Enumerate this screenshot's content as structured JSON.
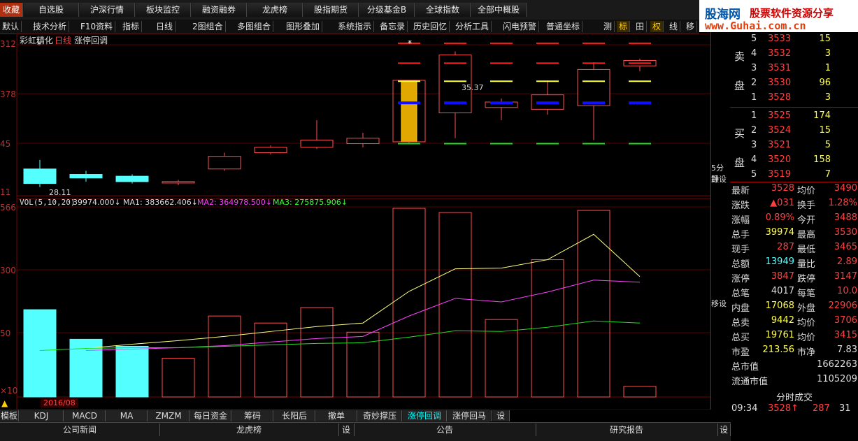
{
  "top_menu": [
    "收藏",
    "自选股",
    "沪深行情",
    "板块监控",
    "融资融券",
    "龙虎榜",
    "股指期货",
    "分级基金B",
    "全球指数",
    "全部中概股"
  ],
  "logo": {
    "brand": "股海网",
    "slogan": "股票软件资源分享",
    "url": "www.Guhai.com.cn"
  },
  "toolbar": [
    "默认",
    "技术分析",
    "F10资料",
    "指标",
    "日线",
    "2图组合",
    "多图组合",
    "图形叠加",
    "系统指示",
    "备忘录",
    "历史回忆",
    "分析工具",
    "闪电预警",
    "普通坐标",
    "测",
    "标",
    "田",
    "权",
    "线",
    "移"
  ],
  "chart": {
    "title": "彩虹精化",
    "period": "日线",
    "indicator": "涨停回调",
    "price_axis": [
      "312",
      "378",
      "45",
      "11"
    ],
    "vol_axis": [
      "566",
      "300",
      "50",
      "×10"
    ],
    "high_annot": "35.37",
    "low_annot": "28.11",
    "date_label": "2016/08",
    "vol_title": "VOL(5,10,20)",
    "vol_val": "39974.000↓",
    "ma1": "MA1: 383662.406↓",
    "ma2": "MA2: 364978.500↓",
    "ma3": "MA3: 275875.906↓"
  },
  "chart_data": {
    "type": "candlestick",
    "candles": [
      {
        "o": 28.9,
        "c": 28.1,
        "h": 29.4,
        "l": 27.9
      },
      {
        "o": 28.6,
        "c": 28.4,
        "h": 28.8,
        "l": 28.2
      },
      {
        "o": 28.5,
        "c": 28.2,
        "h": 28.6,
        "l": 28.1
      },
      {
        "o": 28.2,
        "c": 28.2,
        "h": 28.3,
        "l": 28.0
      },
      {
        "o": 28.9,
        "c": 29.6,
        "h": 29.8,
        "l": 28.8
      },
      {
        "o": 29.8,
        "c": 30.1,
        "h": 30.2,
        "l": 29.7
      },
      {
        "o": 30.1,
        "c": 30.5,
        "h": 31.6,
        "l": 30.0
      },
      {
        "o": 30.3,
        "c": 30.6,
        "h": 30.9,
        "l": 30.1
      },
      {
        "o": 30.4,
        "c": 33.8,
        "h": 33.8,
        "l": 30.3
      },
      {
        "o": 32.0,
        "c": 35.2,
        "h": 35.4,
        "l": 30.6
      },
      {
        "o": 32.3,
        "c": 32.6,
        "h": 32.8,
        "l": 31.6
      },
      {
        "o": 32.2,
        "c": 33.0,
        "h": 33.8,
        "l": 31.9
      },
      {
        "o": 32.4,
        "c": 34.4,
        "h": 34.8,
        "l": 30.5
      },
      {
        "o": 34.6,
        "c": 34.9,
        "h": 35.0,
        "l": 34.3
      }
    ],
    "volume": [
      12.4,
      8.2,
      7.2,
      5.5,
      11.5,
      10.5,
      12.7,
      9.2,
      26.8,
      26.2,
      11.0,
      19.5,
      26.5,
      1.5
    ],
    "ma_yellow": [
      null,
      6.9,
      7.5,
      8.0,
      8.6,
      9.3,
      10.0,
      10.5,
      15.0,
      18.2,
      18.3,
      19.5,
      23.1,
      17.1
    ],
    "ma_magenta": [
      null,
      6.6,
      6.8,
      7.0,
      7.3,
      7.8,
      8.3,
      8.6,
      11.5,
      14.0,
      13.5,
      14.9,
      16.6,
      16.3
    ],
    "ma_green": [
      6.6,
      6.9,
      7.0,
      7.0,
      7.2,
      7.4,
      7.6,
      7.7,
      8.5,
      9.4,
      9.3,
      9.9,
      10.8,
      10.5
    ]
  },
  "quote": {
    "sell": [
      [
        "5",
        "3533",
        "15"
      ],
      [
        "4",
        "3532",
        "3"
      ],
      [
        "3",
        "3531",
        "1"
      ],
      [
        "2",
        "3530",
        "96"
      ],
      [
        "1",
        "3528",
        "3"
      ]
    ],
    "buy": [
      [
        "1",
        "3525",
        "174"
      ],
      [
        "2",
        "3524",
        "15"
      ],
      [
        "3",
        "3521",
        "5"
      ],
      [
        "4",
        "3520",
        "158"
      ],
      [
        "5",
        "3519",
        "7"
      ]
    ],
    "sell_label": [
      "卖",
      "盘"
    ],
    "buy_label": [
      "买",
      "盘"
    ],
    "stats": [
      [
        "最新",
        "3528",
        "均价",
        "3490"
      ],
      [
        "涨跌",
        "▲031",
        "换手",
        "1.28%"
      ],
      [
        "涨幅",
        "0.89%",
        "今开",
        "3488"
      ],
      [
        "总手",
        "39974",
        "最高",
        "3530"
      ],
      [
        "现手",
        "287",
        "最低",
        "3465"
      ],
      [
        "总额",
        "13949",
        "量比",
        "2.89"
      ],
      [
        "涨停",
        "3847",
        "跌停",
        "3147"
      ],
      [
        "总笔",
        "4017",
        "每笔",
        "10.0"
      ],
      [
        "内盘",
        "17068",
        "外盘",
        "22906"
      ],
      [
        "总卖",
        "9442",
        "均价",
        "3706"
      ],
      [
        "总买",
        "19761",
        "均价",
        "3415"
      ],
      [
        "市盈",
        "213.56",
        "市净",
        "7.83"
      ]
    ],
    "mcap_label": "总市值",
    "mcap": "1662263",
    "float_label": "流通市值",
    "float": "1105209",
    "tick_title": "分时成交",
    "tick": [
      "09:34",
      "3528↑",
      "287",
      "31"
    ]
  },
  "side": [
    "5分钟",
    "跟设",
    "移设"
  ],
  "bottom_tabs": [
    "模板",
    "KDJ",
    "MACD",
    "MA",
    "ZMZM",
    "每日资金",
    "筹码",
    "长阳后",
    "撤单",
    "奇妙撑压",
    "涨停回调",
    "涨停回马",
    "设"
  ],
  "news_tabs": [
    "公司新闻",
    "龙虎榜",
    "设",
    "公告",
    "研究报告",
    "设"
  ]
}
